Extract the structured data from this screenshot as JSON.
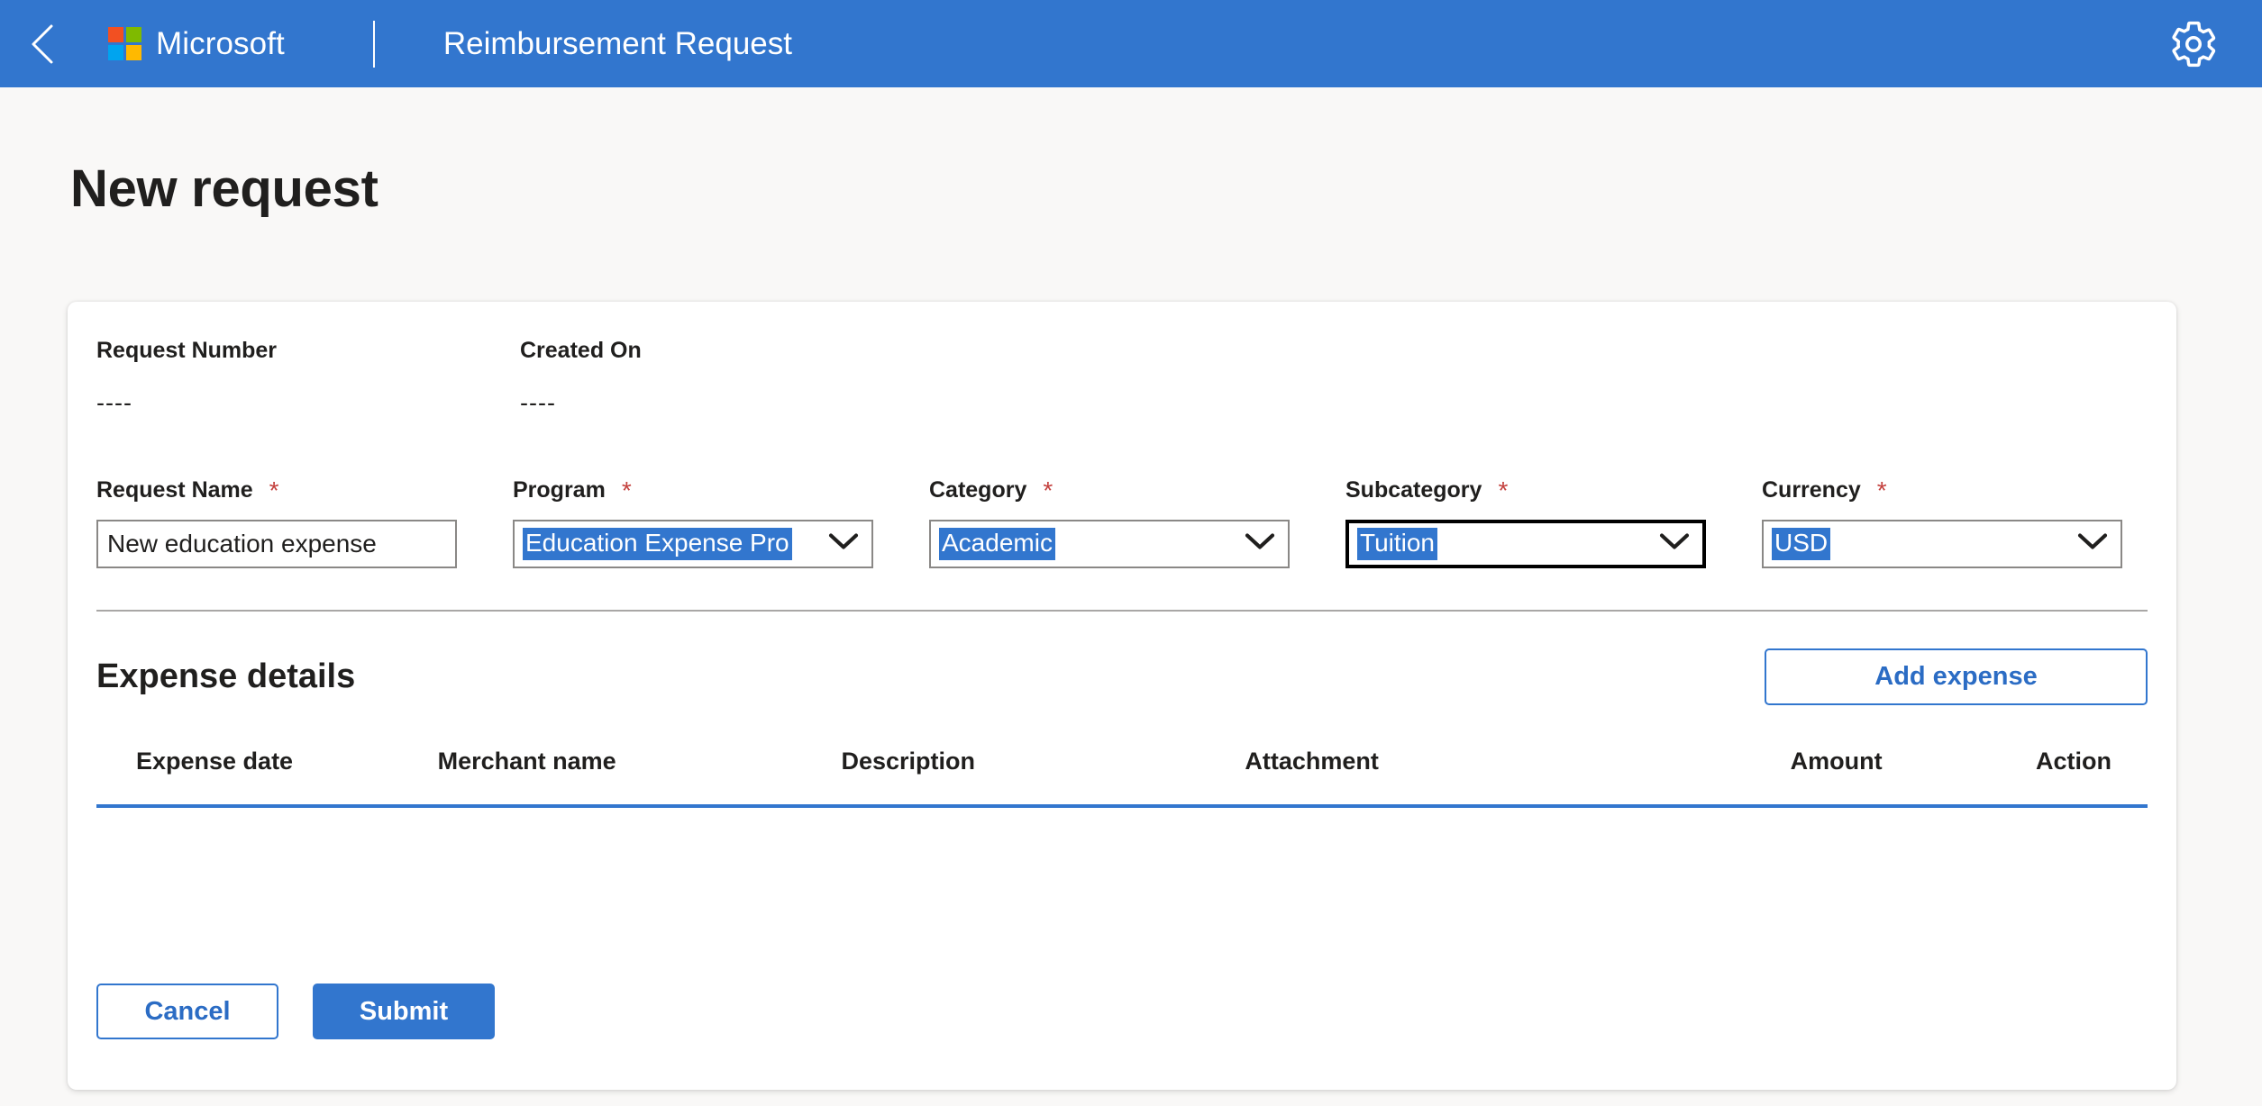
{
  "header": {
    "back_icon": "back-chevron-icon",
    "brand": "Microsoft",
    "title": "Reimbursement Request",
    "settings_icon": "gear-icon",
    "bar_color": "#3276ce",
    "logo_colors": [
      "#f25022",
      "#7fba00",
      "#00a4ef",
      "#ffb900"
    ]
  },
  "page": {
    "title": "New request",
    "background": "#f9f8f7"
  },
  "meta": [
    {
      "label": "Request Number",
      "value": "----"
    },
    {
      "label": "Created On",
      "value": "----"
    }
  ],
  "fields": [
    {
      "label": "Request Name",
      "required": "*",
      "type": "text",
      "value": "New education expense",
      "placeholder": "",
      "selected": false,
      "focused": false
    },
    {
      "label": "Program",
      "required": "*",
      "type": "select",
      "value": "Education Expense Pro",
      "full_value": "Education Expense Program",
      "selected": true,
      "focused": false
    },
    {
      "label": "Category",
      "required": "*",
      "type": "select",
      "value": "Academic",
      "selected": true,
      "focused": false
    },
    {
      "label": "Subcategory",
      "required": "*",
      "type": "select",
      "value": "Tuition",
      "selected": true,
      "focused": true
    },
    {
      "label": "Currency",
      "required": "*",
      "type": "select",
      "value": "USD",
      "selected": true,
      "focused": false
    }
  ],
  "expense_section": {
    "title": "Expense details",
    "add_button": "Add expense",
    "columns": [
      "Expense date",
      "Merchant name",
      "Description",
      "Attachment",
      "Amount",
      "Action"
    ],
    "rows": [],
    "underline_color": "#3276ce"
  },
  "footer": {
    "cancel_label": "Cancel",
    "submit_label": "Submit",
    "accent": "#3276ce"
  },
  "colors": {
    "accent": "#3276ce",
    "required_star": "#c4413e",
    "selection_highlight": "#3276ce",
    "text": "#201f1e",
    "field_border": "#8a8886"
  }
}
